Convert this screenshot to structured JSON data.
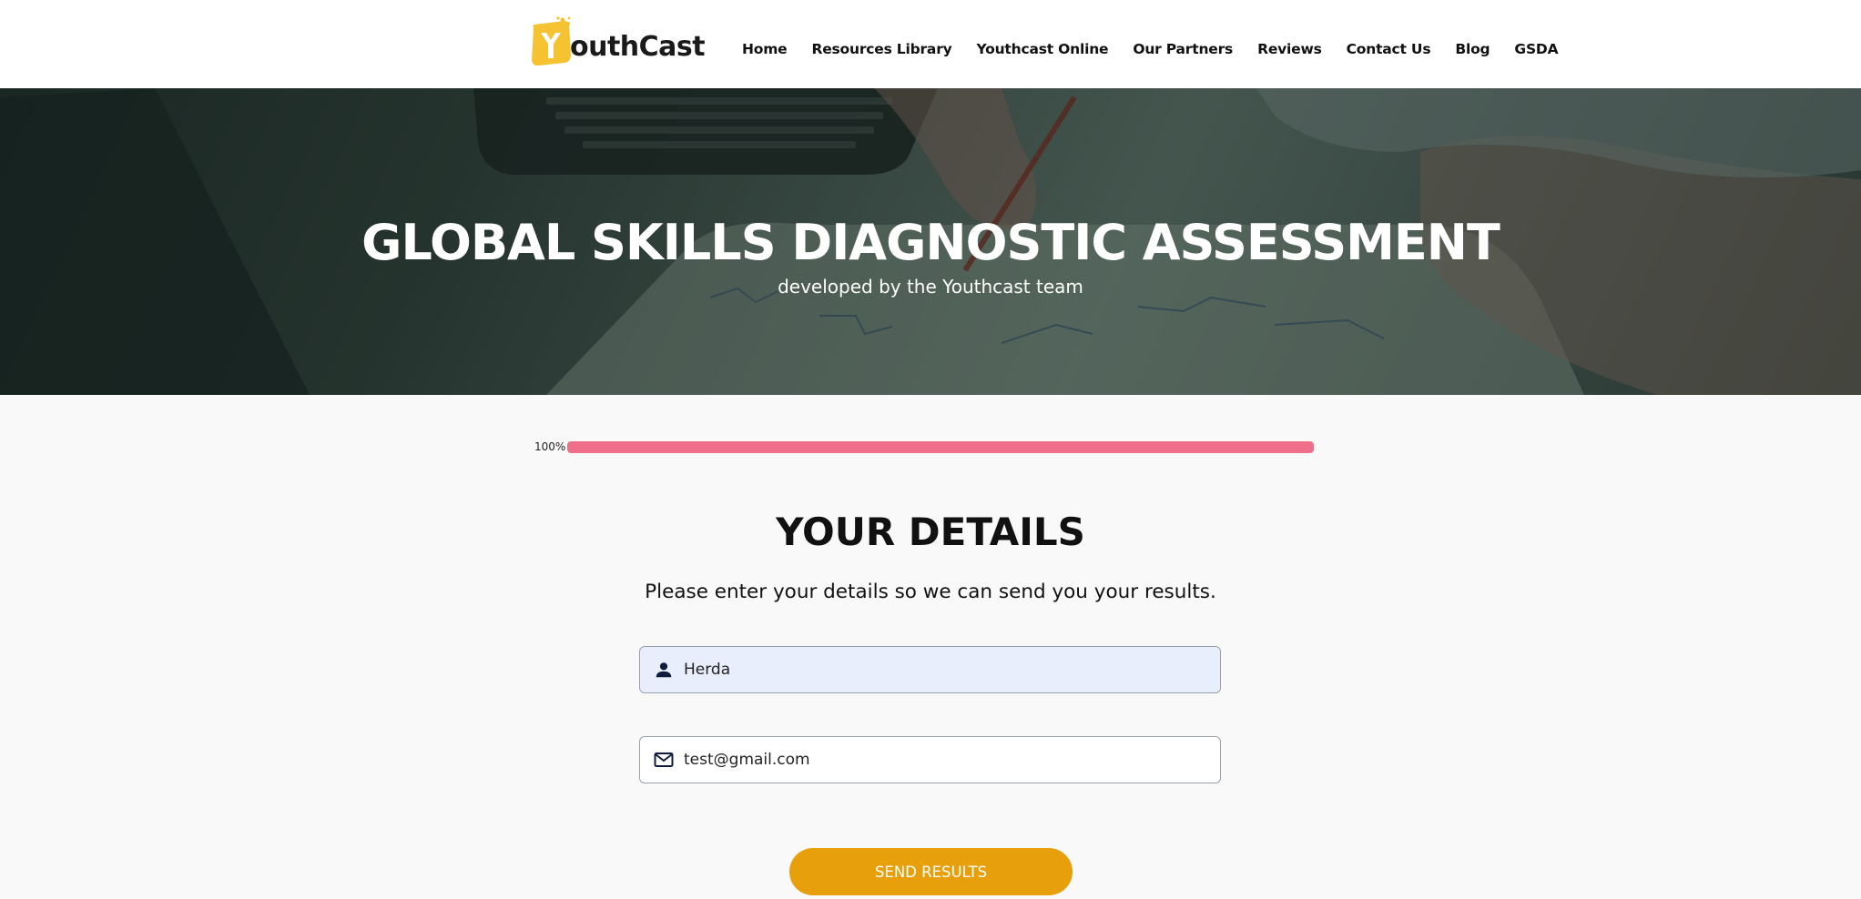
{
  "brand": {
    "name": "outhCast",
    "logo_letter": "Y",
    "color": "#f5c232"
  },
  "nav": {
    "items": [
      {
        "label": "Home"
      },
      {
        "label": "Resources Library"
      },
      {
        "label": "Youthcast Online"
      },
      {
        "label": "Our Partners"
      },
      {
        "label": "Reviews"
      },
      {
        "label": "Contact Us"
      },
      {
        "label": "Blog"
      },
      {
        "label": "GSDA"
      }
    ]
  },
  "hero": {
    "title": "GLOBAL SKILLS DIAGNOSTIC ASSESSMENT",
    "subtitle": "developed by the Youthcast team"
  },
  "progress": {
    "label": "100%",
    "value": 1.0,
    "color": "#ef6f8b"
  },
  "details": {
    "title": "YOUR DETAILS",
    "description": "Please enter your details so we can send you your results.",
    "name_field": {
      "value": "Herda",
      "icon": "person-icon"
    },
    "email_field": {
      "value": "test@gmail.com",
      "icon": "mail-icon"
    },
    "submit_label": "SEND RESULTS",
    "submit_color": "#e89f0c"
  }
}
